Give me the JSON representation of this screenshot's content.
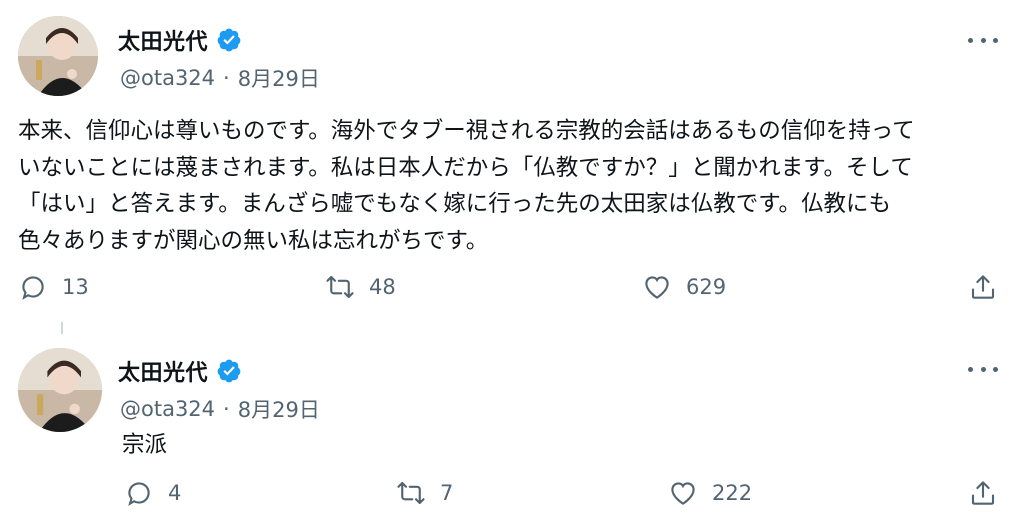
{
  "tweets": [
    {
      "author": {
        "name": "太田光代",
        "handle": "@ota324",
        "date": "8月29日"
      },
      "separator": "·",
      "text": "本来、信仰心は尊いものです。海外でタブー視される宗教的会話はあるもの信仰を持って\nいないことには蔑まされます。私は日本人だから「仏教ですか？」と聞かれます。そして\n「はい」と答えます。まんざら嘘でもなく嫁に行った先の太田家は仏教です。仏教にも\n色々ありますが関心の無い私は忘れがちです。",
      "stats": {
        "replies": "13",
        "retweets": "48",
        "likes": "629"
      }
    },
    {
      "author": {
        "name": "太田光代",
        "handle": "@ota324",
        "date": "8月29日"
      },
      "separator": "·",
      "text": "宗派",
      "stats": {
        "replies": "4",
        "retweets": "7",
        "likes": "222"
      }
    }
  ],
  "icons": {
    "verified": "verified-badge-icon",
    "more": "more-dots-icon",
    "reply": "reply-icon",
    "retweet": "retweet-icon",
    "like": "heart-icon",
    "share": "share-icon"
  },
  "colors": {
    "verified": "#1d9bf0",
    "muted": "#536471",
    "text": "#0f1419"
  }
}
